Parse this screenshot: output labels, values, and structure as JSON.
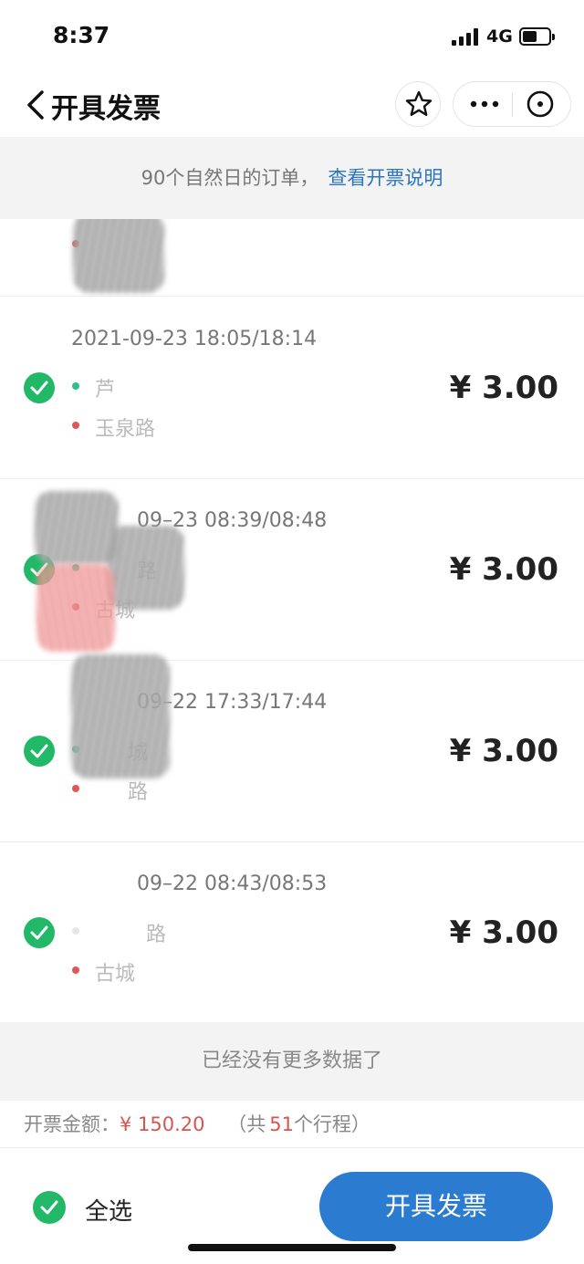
{
  "status_bar": {
    "time": "8:37",
    "network": "4G",
    "battery_level": 0.55
  },
  "nav": {
    "title": "开具发票",
    "icons": [
      "back-icon",
      "star-icon",
      "more-icon",
      "close-circle-icon"
    ]
  },
  "notice": {
    "text": "90个自然日的订单，",
    "link_text": "查看开票说明"
  },
  "orders": [
    {
      "time": "",
      "start": "",
      "end": "",
      "price": ""
    },
    {
      "time": "2021-09-23 18:05/18:14",
      "start": "芦",
      "end": "玉泉路",
      "price": "¥ 3.00"
    },
    {
      "time": "09–23 08:39/08:48",
      "start": "路",
      "end": "古城",
      "price": "¥ 3.00"
    },
    {
      "time": "09–22 17:33/17:44",
      "start": "城",
      "end": "路",
      "price": "¥ 3.00"
    },
    {
      "time": "09–22 08:43/08:53",
      "start": "路",
      "end": "古城",
      "price": "¥ 3.00"
    }
  ],
  "list_footer": "已经没有更多数据了",
  "summary": {
    "label": "开票金额：",
    "amount": "¥ 150.20",
    "count_prefix": "（共",
    "count": "51",
    "count_suffix": "个行程）"
  },
  "bottom": {
    "select_all": "全选",
    "button": "开具发票"
  },
  "colors": {
    "accent_blue": "#2b7bd1",
    "check_green": "#21b968",
    "amount_red": "#d9534f"
  }
}
